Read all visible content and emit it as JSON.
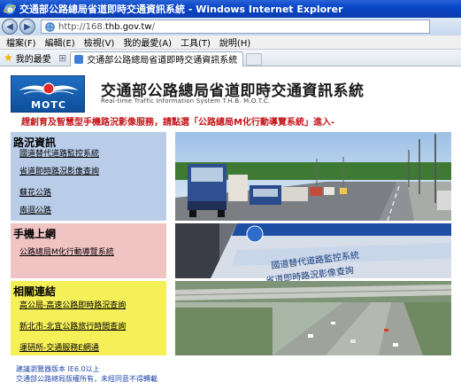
{
  "window": {
    "title": "交通部公路總局省道即時交通資訊系統 - Windows Internet Explorer"
  },
  "address": {
    "prefix": "http://168.",
    "host": "thb.gov.tw",
    "suffix": "/"
  },
  "menu": [
    "檔案(F)",
    "編輯(E)",
    "檢視(V)",
    "我的最愛(A)",
    "工具(T)",
    "說明(H)"
  ],
  "favorites_label": "我的最愛",
  "tab_title": "交通部公路總局省道即時交通資訊系統",
  "site": {
    "logo_text": "MOTC",
    "title": "交通部公路總局省道即時交通資訊系統",
    "subtitle": "Real-time Traffic Information System T.H.B. M.O.T.C.",
    "promo": "趕創育及智慧型手機路況影像服務，請點選「公路總局M化行動導覽系統」進入-"
  },
  "sections": {
    "traffic": {
      "heading": "路況資訊",
      "links": [
        "國道替代道路監控系統",
        "省道即時路況影像查詢",
        "蘇花公路",
        "南迴公路"
      ]
    },
    "mobile": {
      "heading": "手機上網",
      "links": [
        "公路總局M化行動導覽系統"
      ]
    },
    "related": {
      "heading": "相關連結",
      "links": [
        "高公局-高速公路即時路況查詢",
        "新北市-北宜公路旅行時間查詢",
        "運研所-交通服務E網通"
      ]
    }
  },
  "phone_screen": {
    "line1": "國道替代道路監控系統",
    "line2": "省道即時路況影像查詢"
  },
  "footer": {
    "line1": "建議瀏覽器版本 IE6.0以上",
    "line2": "交通部公路總局版權所有，未經同意不得轉載"
  }
}
